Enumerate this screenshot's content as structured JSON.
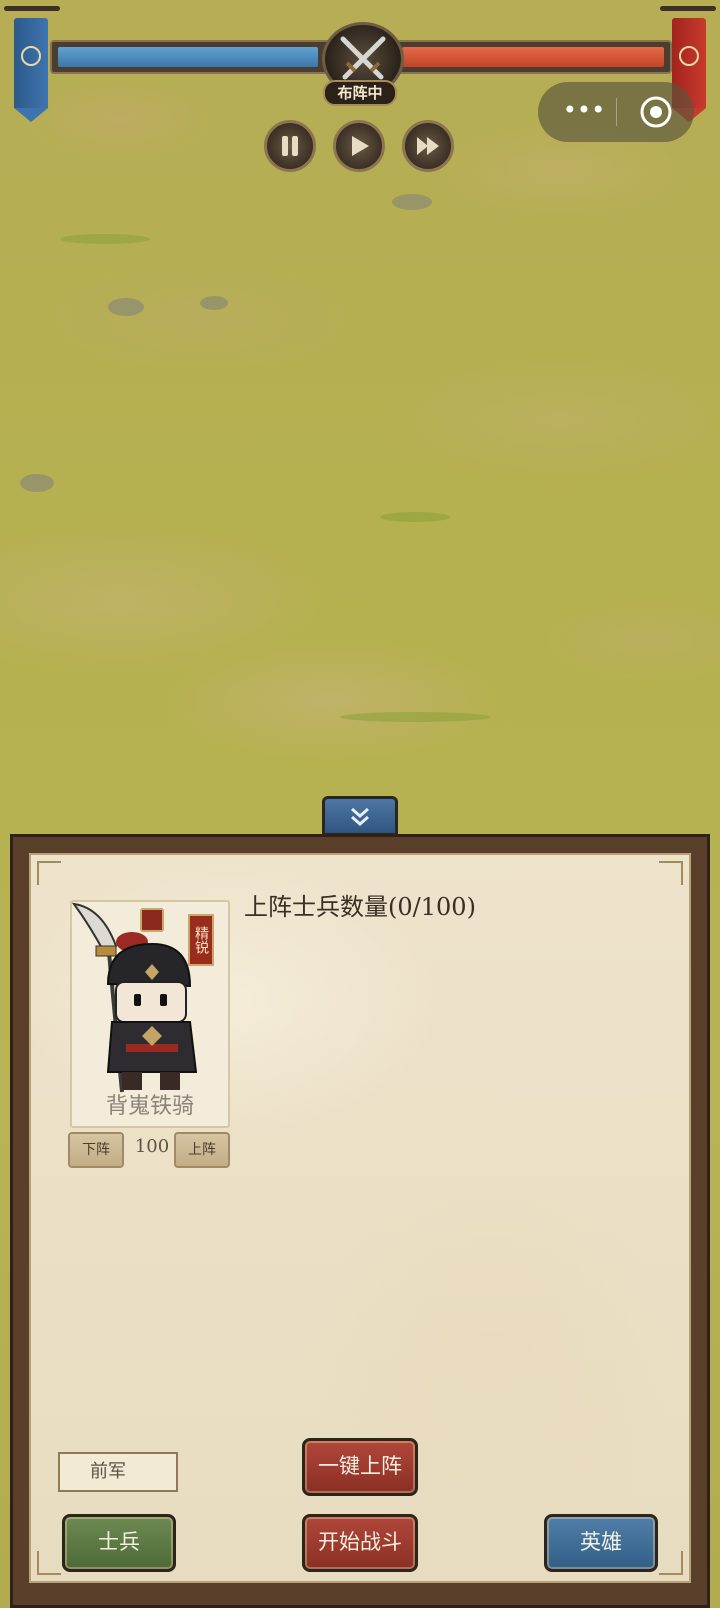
{
  "top_bar": {
    "status": "布阵中",
    "player_hp_fraction": 1.0,
    "enemy_hp_fraction": 1.0,
    "colors": {
      "player": "#3d77aa",
      "enemy": "#c34428"
    }
  },
  "controls": {
    "pause_icon": "pause-icon",
    "play_icon": "play-icon",
    "fast_forward_icon": "fast-forward-icon"
  },
  "mini_program_capsule": {
    "more_label": "•••",
    "close_icon": "target-icon"
  },
  "panel": {
    "title": "上阵士兵数量(0/100)",
    "unit_card": {
      "name": "背嵬铁骑",
      "badge": "精锐",
      "count": "100",
      "remove_label": "下阵",
      "deploy_label": "上阵"
    },
    "army_position": "前军",
    "auto_deploy_label": "一键上阵",
    "start_battle_label": "开始战斗",
    "soldiers_tab_label": "士兵",
    "heroes_tab_label": "英雄"
  }
}
